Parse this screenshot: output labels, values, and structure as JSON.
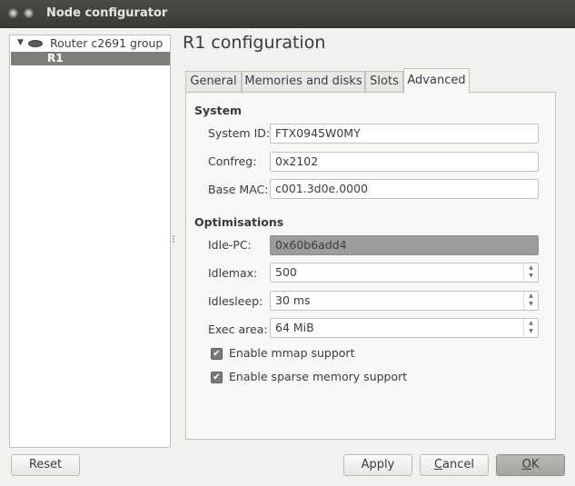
{
  "window": {
    "title": "Node configurator"
  },
  "tree": {
    "group_label": "Router c2691 group",
    "selected_item": "R1"
  },
  "heading": "R1 configuration",
  "tabs": [
    {
      "label": "General"
    },
    {
      "label": "Memories and disks"
    },
    {
      "label": "Slots"
    },
    {
      "label": "Advanced",
      "active": true
    }
  ],
  "system": {
    "title": "System",
    "system_id_label": "System ID:",
    "system_id_value": "FTX0945W0MY",
    "confreg_label": "Confreg:",
    "confreg_value": "0x2102",
    "base_mac_label": "Base MAC:",
    "base_mac_value": "c001.3d0e.0000"
  },
  "optimisations": {
    "title": "Optimisations",
    "idle_pc_label": "Idle-PC:",
    "idle_pc_value": "0x60b6add4",
    "idlemax_label": "Idlemax:",
    "idlemax_value": "500",
    "idlesleep_label": "Idlesleep:",
    "idlesleep_value": "30 ms",
    "exec_area_label": "Exec area:",
    "exec_area_value": "64 MiB",
    "mmap_label": "Enable mmap support",
    "mmap_checked": true,
    "sparse_label": "Enable sparse memory support",
    "sparse_checked": true
  },
  "buttons": {
    "reset": "Reset",
    "apply": "Apply",
    "cancel_prefix": "",
    "cancel_mnemonic": "C",
    "cancel_rest": "ancel",
    "ok_mnemonic": "O",
    "ok_rest": "K"
  },
  "icons": {
    "close": "close-icon",
    "minimize": "minimize-icon",
    "expand": "expand-arrow-icon",
    "router": "router-icon",
    "spin_arrows": "spin-arrows-icon",
    "checkmark": "checkmark-icon"
  }
}
